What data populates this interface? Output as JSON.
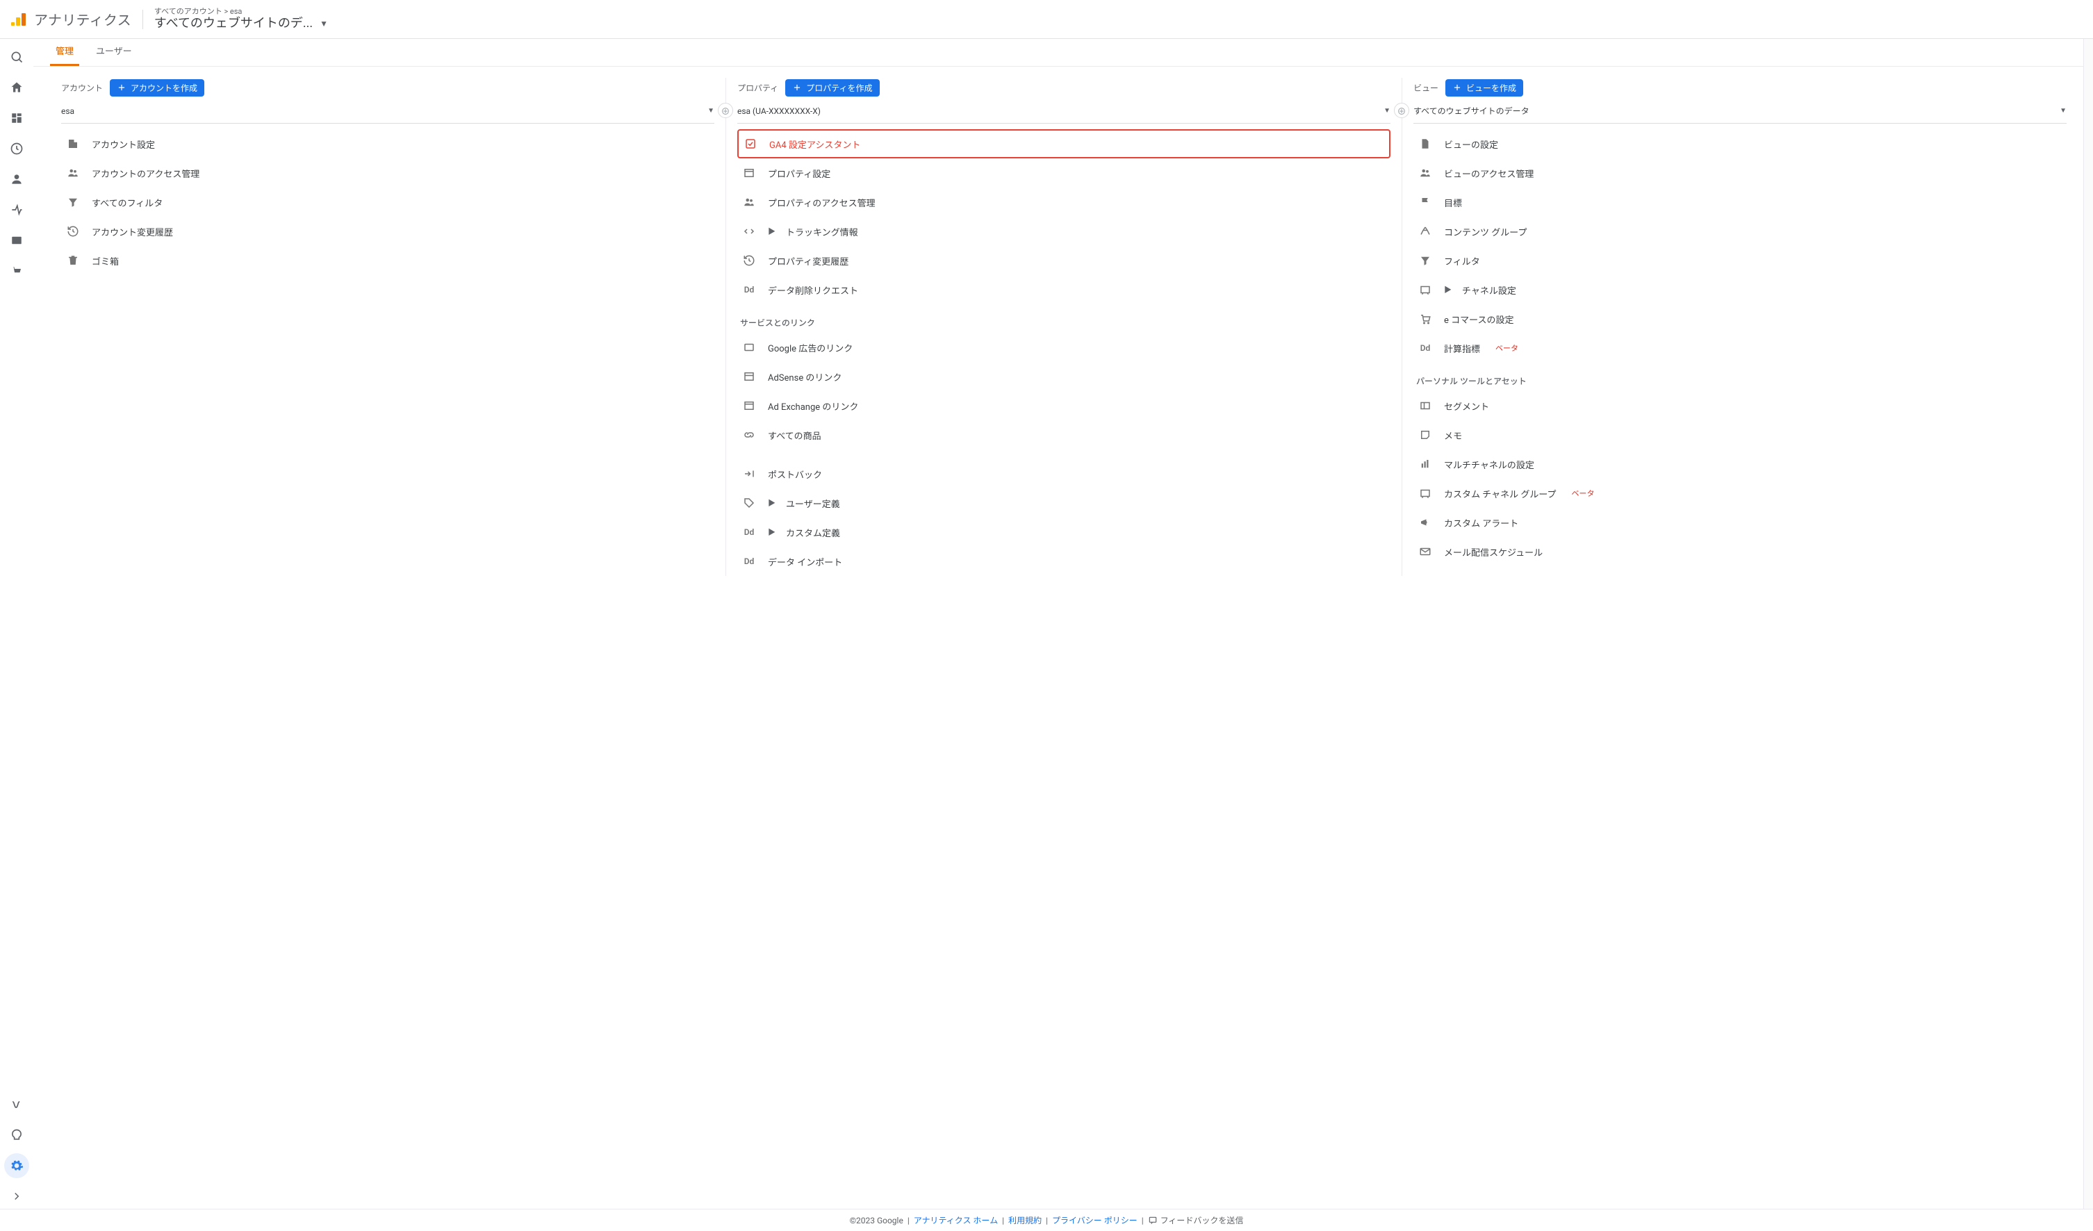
{
  "header": {
    "app_title": "アナリティクス",
    "breadcrumb_allaccounts": "すべてのアカウント",
    "breadcrumb_current": "esa",
    "view_title": "すべてのウェブサイトのデ..."
  },
  "tabs": {
    "admin": "管理",
    "user": "ユーザー"
  },
  "col_account": {
    "label": "アカウント",
    "create_btn": "アカウントを作成",
    "selected": "esa",
    "items": {
      "settings": "アカウント設定",
      "access": "アカウントのアクセス管理",
      "filters": "すべてのフィルタ",
      "history": "アカウント変更履歴",
      "trash": "ゴミ箱"
    }
  },
  "col_property": {
    "label": "プロパティ",
    "create_btn": "プロパティを作成",
    "selected": "esa (UA-XXXXXXXX-X)",
    "items": {
      "ga4": "GA4 設定アシスタント",
      "settings": "プロパティ設定",
      "access": "プロパティのアクセス管理",
      "tracking": "トラッキング情報",
      "history": "プロパティ変更履歴",
      "del_req": "データ削除リクエスト"
    },
    "link_section": "サービスとのリンク",
    "links": {
      "ads": "Google 広告のリンク",
      "adsense": "AdSense のリンク",
      "adx": "Ad Exchange のリンク",
      "products": "すべての商品"
    },
    "more": {
      "postback": "ポストバック",
      "userdef": "ユーザー定義",
      "customdef": "カスタム定義",
      "import": "データ インポート"
    }
  },
  "col_view": {
    "label": "ビュー",
    "create_btn": "ビューを作成",
    "selected": "すべてのウェブサイトのデータ",
    "items": {
      "view_settings": "ビューの設定",
      "access": "ビューのアクセス管理",
      "goals": "目標",
      "content_groups": "コンテンツ グループ",
      "filters": "フィルタ",
      "channels": "チャネル設定",
      "ecommerce": "e コマースの設定",
      "calc": "計算指標",
      "calc_badge": "ベータ"
    },
    "personal_section": "パーソナル ツールとアセット",
    "personal": {
      "segments": "セグメント",
      "notes": "メモ",
      "multichannel": "マルチチャネルの設定",
      "custom_channel": "カスタム チャネル グループ",
      "custom_channel_badge": "ベータ",
      "alerts": "カスタム アラート",
      "mail": "メール配信スケジュール"
    }
  },
  "footer": {
    "copyright": "©2023 Google",
    "home": "アナリティクス ホーム",
    "terms": "利用規約",
    "privacy": "プライバシー ポリシー",
    "feedback": "フィードバックを送信",
    "sep": " | "
  }
}
